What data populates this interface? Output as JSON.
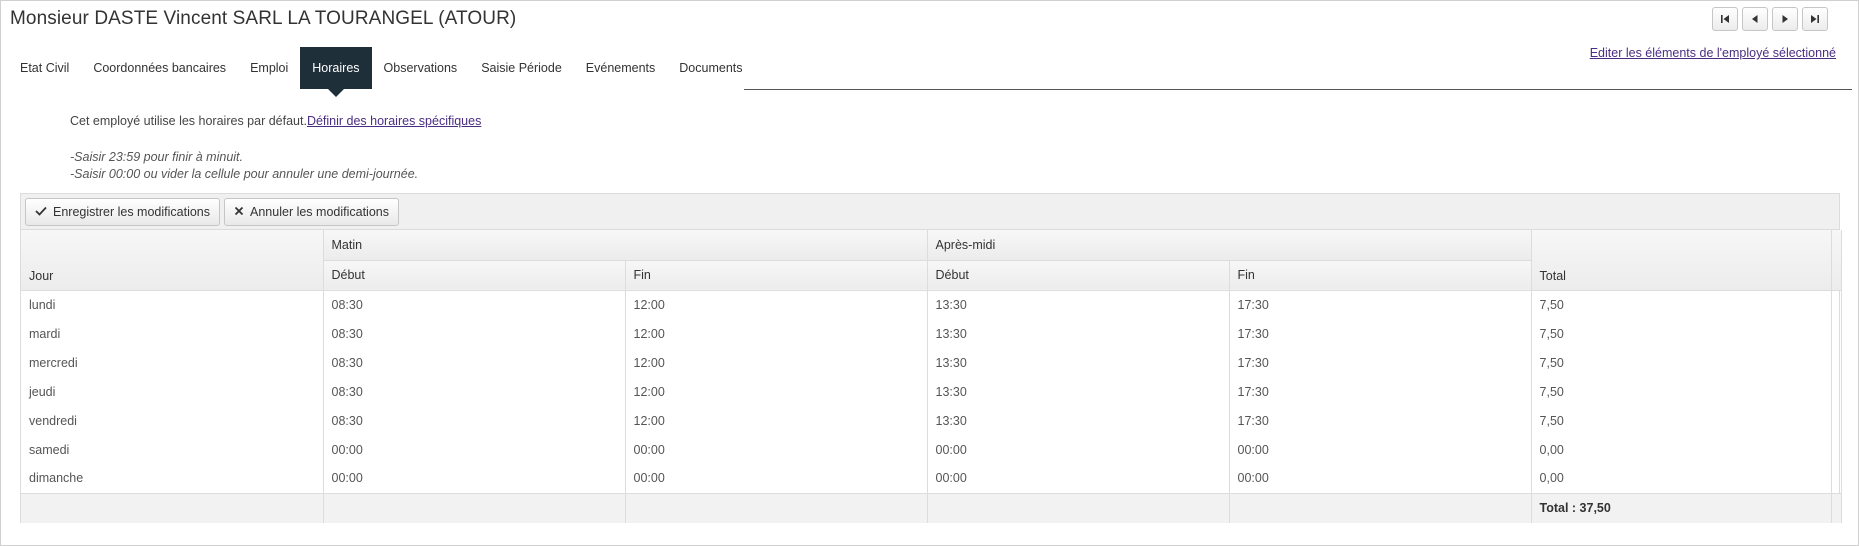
{
  "header": {
    "title": "Monsieur DASTE Vincent SARL LA TOURANGEL (ATOUR)",
    "edit_link": "Editer les éléments de l'employé sélectionné"
  },
  "nav_buttons": [
    {
      "icon": "first-icon"
    },
    {
      "icon": "prev-icon"
    },
    {
      "icon": "next-icon"
    },
    {
      "icon": "last-icon"
    }
  ],
  "tabs": [
    {
      "label": "Etat Civil",
      "active": false
    },
    {
      "label": "Coordonnées bancaires",
      "active": false
    },
    {
      "label": "Emploi",
      "active": false
    },
    {
      "label": "Horaires",
      "active": true
    },
    {
      "label": "Observations",
      "active": false
    },
    {
      "label": "Saisie Période",
      "active": false
    },
    {
      "label": "Evénements",
      "active": false
    },
    {
      "label": "Documents",
      "active": false
    }
  ],
  "info": {
    "text": "Cet employé utilise les horaires par défaut.",
    "link": "Définir des horaires spécifiques",
    "hint1": "-Saisir 23:59 pour finir à minuit.",
    "hint2": "-Saisir 00:00 ou vider la cellule pour annuler une demi-journée."
  },
  "toolbar": {
    "save_label": "Enregistrer les modifications",
    "cancel_label": "Annuler les modifications"
  },
  "table": {
    "group_headers": {
      "matin": "Matin",
      "apres_midi": "Après-midi"
    },
    "columns": {
      "jour": "Jour",
      "debut1": "Début",
      "fin1": "Fin",
      "debut2": "Début",
      "fin2": "Fin",
      "total": "Total"
    },
    "rows": [
      [
        "lundi",
        "08:30",
        "12:00",
        "13:30",
        "17:30",
        "7,50"
      ],
      [
        "mardi",
        "08:30",
        "12:00",
        "13:30",
        "17:30",
        "7,50"
      ],
      [
        "mercredi",
        "08:30",
        "12:00",
        "13:30",
        "17:30",
        "7,50"
      ],
      [
        "jeudi",
        "08:30",
        "12:00",
        "13:30",
        "17:30",
        "7,50"
      ],
      [
        "vendredi",
        "08:30",
        "12:00",
        "13:30",
        "17:30",
        "7,50"
      ],
      [
        "samedi",
        "00:00",
        "00:00",
        "00:00",
        "00:00",
        "0,00"
      ],
      [
        "dimanche",
        "00:00",
        "00:00",
        "00:00",
        "00:00",
        "0,00"
      ]
    ],
    "footer_total": "Total : 37,50"
  },
  "colors": {
    "active_tab": "#1f2f3a",
    "link": "#4b2e83"
  }
}
